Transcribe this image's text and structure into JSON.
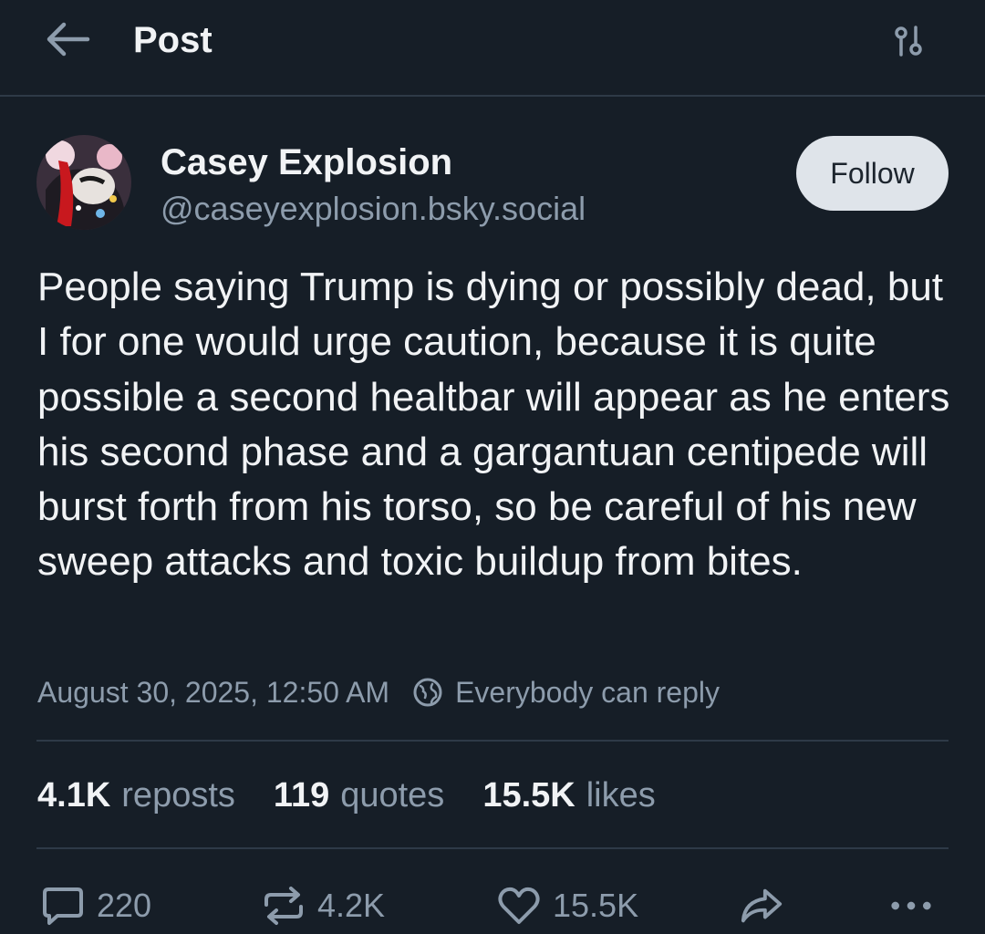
{
  "header": {
    "title": "Post",
    "back_icon": "arrow-left-icon",
    "settings_icon": "sliders-icon"
  },
  "author": {
    "display_name": "Casey Explosion",
    "handle": "@caseyexplosion.bsky.social",
    "follow_label": "Follow"
  },
  "post": {
    "text": "People saying Trump is dying or possibly dead, but I for one would urge caution, because it is quite possible a second healtbar will appear as he enters his second phase and a gargantuan centipede will burst forth from his torso, so be careful of his new sweep attacks and toxic buildup from bites.",
    "timestamp": "August 30, 2025, 12:50 AM",
    "reply_setting": "Everybody can reply"
  },
  "stats": {
    "reposts_count": "4.1K",
    "reposts_label": "reposts",
    "quotes_count": "119",
    "quotes_label": "quotes",
    "likes_count": "15.5K",
    "likes_label": "likes"
  },
  "actions": {
    "reply_count": "220",
    "repost_count": "4.2K",
    "like_count": "15.5K"
  },
  "colors": {
    "background": "#161e27",
    "text": "#f1f3f5",
    "muted": "#8d9cac",
    "divider": "#2e3a47",
    "follow_bg": "#dfe4ea"
  }
}
